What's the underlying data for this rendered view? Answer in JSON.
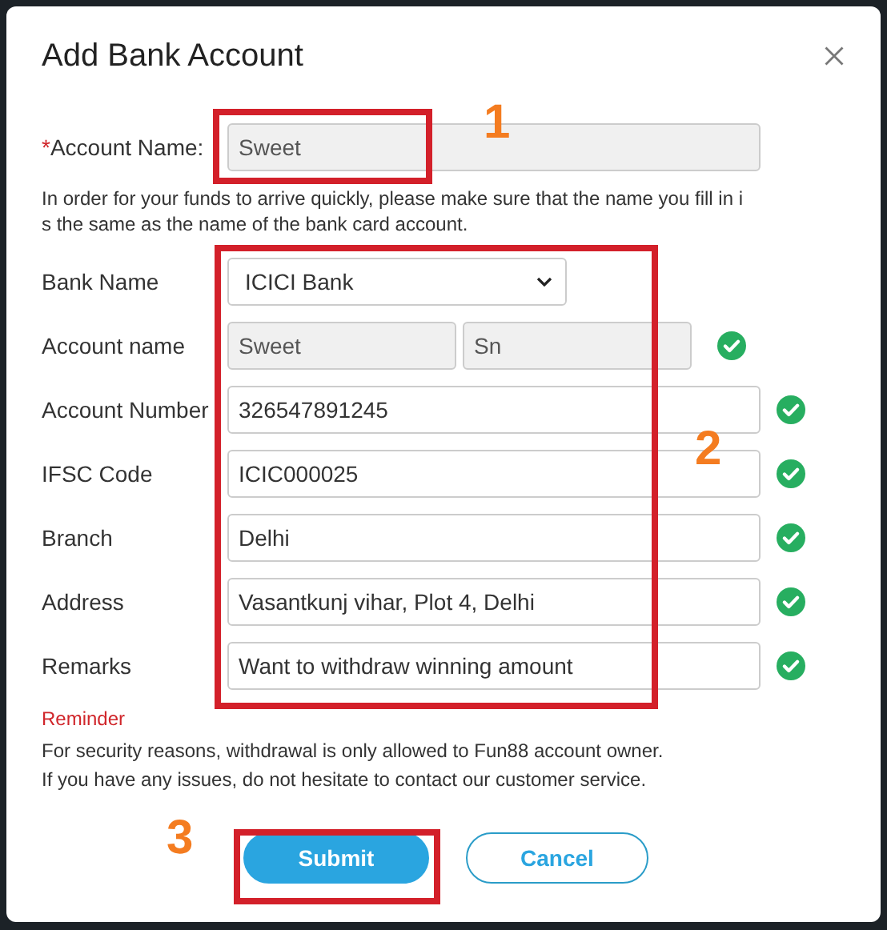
{
  "dialog": {
    "title": "Add Bank Account"
  },
  "account_name": {
    "required_mark": "*",
    "label": "Account Name:",
    "value": "Sweet",
    "readonly": true
  },
  "note_lines": [
    "In order for your funds to arrive quickly, please make sure that the name you fill in i",
    "s the same as the name of the bank card account."
  ],
  "fields": [
    {
      "kind": "select",
      "label": "Bank Name",
      "value": "ICICI Bank",
      "readonly": false,
      "valid": false
    },
    {
      "kind": "split",
      "label": "Account name",
      "values": [
        "Sweet",
        "Sn"
      ],
      "readonly": true,
      "valid": true
    },
    {
      "kind": "text",
      "label": "Account Number",
      "value": "326547891245",
      "readonly": false,
      "valid": true
    },
    {
      "kind": "text",
      "label": "IFSC Code",
      "value": "ICIC000025",
      "readonly": false,
      "valid": true
    },
    {
      "kind": "text",
      "label": "Branch",
      "value": "Delhi",
      "readonly": false,
      "valid": true
    },
    {
      "kind": "text",
      "label": "Address",
      "value": "Vasantkunj vihar, Plot 4, Delhi",
      "readonly": false,
      "valid": true
    },
    {
      "kind": "text",
      "label": "Remarks",
      "value": "Want to withdraw winning amount",
      "readonly": false,
      "valid": true
    }
  ],
  "reminder": {
    "title": "Reminder",
    "lines": [
      "For security reasons, withdrawal is only allowed to Fun88 account owner.",
      "If you have any issues, do not hesitate to contact our customer service."
    ]
  },
  "buttons": [
    {
      "kind": "primary",
      "label": "Submit"
    },
    {
      "kind": "secondary",
      "label": "Cancel"
    }
  ],
  "annotations": [
    {
      "number": "1"
    },
    {
      "number": "2"
    },
    {
      "number": "3"
    }
  ]
}
